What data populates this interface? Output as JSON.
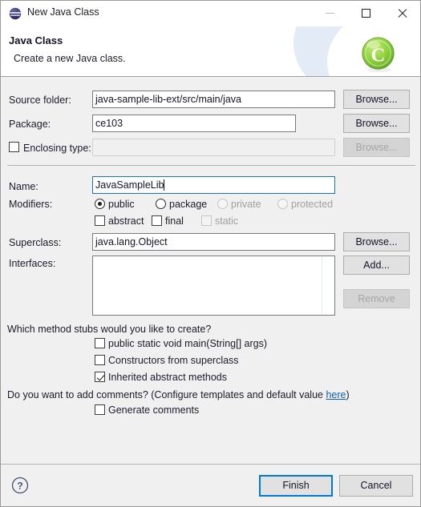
{
  "window": {
    "title": "New Java Class",
    "icon": "java-class-icon",
    "controls": {
      "minimize": "minimize-icon",
      "maximize": "maximize-icon",
      "close": "close-icon"
    }
  },
  "banner": {
    "title": "Java Class",
    "subtitle": "Create a new Java class.",
    "logo": "new-java-class-logo",
    "logo_letter": "C",
    "logo_color": "#7ac943"
  },
  "form": {
    "source_folder": {
      "label": "Source folder:",
      "value": "java-sample-lib-ext/src/main/java",
      "button": "Browse..."
    },
    "package": {
      "label": "Package:",
      "value": "ce103",
      "button": "Browse..."
    },
    "enclosing_type": {
      "label": "Enclosing type:",
      "value": "",
      "checked": false,
      "enabled": false,
      "button": "Browse..."
    },
    "name": {
      "label": "Name:",
      "value": "JavaSampleLib",
      "focused": true
    },
    "modifiers": {
      "label": "Modifiers:",
      "radios": [
        {
          "label": "public",
          "checked": true,
          "enabled": true
        },
        {
          "label": "package",
          "checked": false,
          "enabled": true
        },
        {
          "label": "private",
          "checked": false,
          "enabled": false
        },
        {
          "label": "protected",
          "checked": false,
          "enabled": false
        }
      ],
      "checkboxes": [
        {
          "label": "abstract",
          "checked": false,
          "enabled": true
        },
        {
          "label": "final",
          "checked": false,
          "enabled": true
        },
        {
          "label": "static",
          "checked": false,
          "enabled": false
        }
      ]
    },
    "superclass": {
      "label": "Superclass:",
      "value": "java.lang.Object",
      "button": "Browse..."
    },
    "interfaces": {
      "label": "Interfaces:",
      "items": [],
      "add_button": "Add...",
      "remove_button": "Remove"
    },
    "stubs": {
      "question": "Which method stubs would you like to create?",
      "options": [
        {
          "label": "public static void main(String[] args)",
          "checked": false
        },
        {
          "label": "Constructors from superclass",
          "checked": false
        },
        {
          "label": "Inherited abstract methods",
          "checked": true
        }
      ]
    },
    "comments": {
      "question_prefix": "Do you want to add comments? (Configure templates and default value ",
      "link": "here",
      "question_suffix": ")",
      "option": {
        "label": "Generate comments",
        "checked": false
      }
    }
  },
  "footer": {
    "help": "help-icon",
    "finish": "Finish",
    "cancel": "Cancel"
  }
}
